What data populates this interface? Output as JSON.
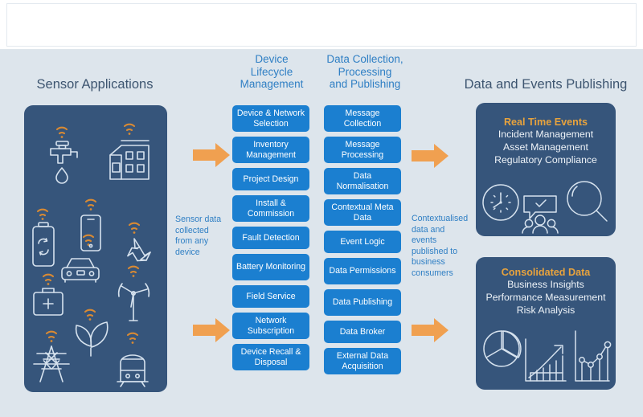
{
  "headings": {
    "sensor_applications": "Sensor Applications",
    "device_lifecycle_management": "Device\nLifecycle\nManagement",
    "data_collection_processing_publishing": "Data Collection,\nProcessing\nand Publishing",
    "data_and_events_publishing": "Data and Events Publishing"
  },
  "colors": {
    "background": "#dde5ec",
    "panel_dark": "#36557b",
    "box_blue": "#1b7fd0",
    "arrow_orange": "#f0a050",
    "heading_slate": "#3d5570",
    "heading_blue": "#2f7fc4",
    "accent_orange": "#e8a33d",
    "icon_stroke": "#d6e2ee",
    "wifi_orange": "#d98a33"
  },
  "device_lifecycle_management": {
    "boxes": [
      "Device & Network Selection",
      "Inventory Management",
      "Project Design",
      "Install & Commission",
      "Fault Detection",
      "Battery Monitoring",
      "Field Service",
      "Network Subscription",
      "Device Recall & Disposal"
    ]
  },
  "data_collection_processing_publishing": {
    "boxes": [
      "Message Collection",
      "Message Processing",
      "Data Normalisation",
      "Contextual Meta Data",
      "Event Logic",
      "Data Permissions",
      "Data Publishing",
      "Data Broker",
      "External Data Acquisition"
    ]
  },
  "connectors": {
    "left_caption": "Sensor data collected from any device",
    "right_caption": "Contextualised data and events published to business consumers",
    "arrows": [
      "arrow-sensors-to-lifecycle-top",
      "arrow-sensors-to-lifecycle-bottom",
      "arrow-processing-to-publishing-top",
      "arrow-processing-to-publishing-bottom"
    ]
  },
  "data_events_publishing": {
    "real_time_events": {
      "title": "Real Time Events",
      "lines": [
        "Incident Management",
        "Asset Management",
        "Regulatory Compliance"
      ],
      "icons": [
        "clock-icon",
        "speech-bubble-check-people-icon",
        "magnifying-glass-icon"
      ]
    },
    "consolidated_data": {
      "title": "Consolidated Data",
      "lines": [
        "Business Insights",
        "Performance Measurement",
        "Risk Analysis"
      ],
      "icons": [
        "pie-chart-icon",
        "growth-bar-chart-arrow-icon",
        "line-chart-icon"
      ]
    }
  },
  "sensor_applications": {
    "icons": [
      "water-tap-icon",
      "building-icon",
      "battery-recycle-icon",
      "smartphone-icon",
      "recycling-icon",
      "car-icon",
      "medical-case-icon",
      "wind-turbine-icon",
      "leaf-plant-icon",
      "power-pylon-icon",
      "train-icon"
    ],
    "signal_badge": "wifi-signal-icon"
  }
}
